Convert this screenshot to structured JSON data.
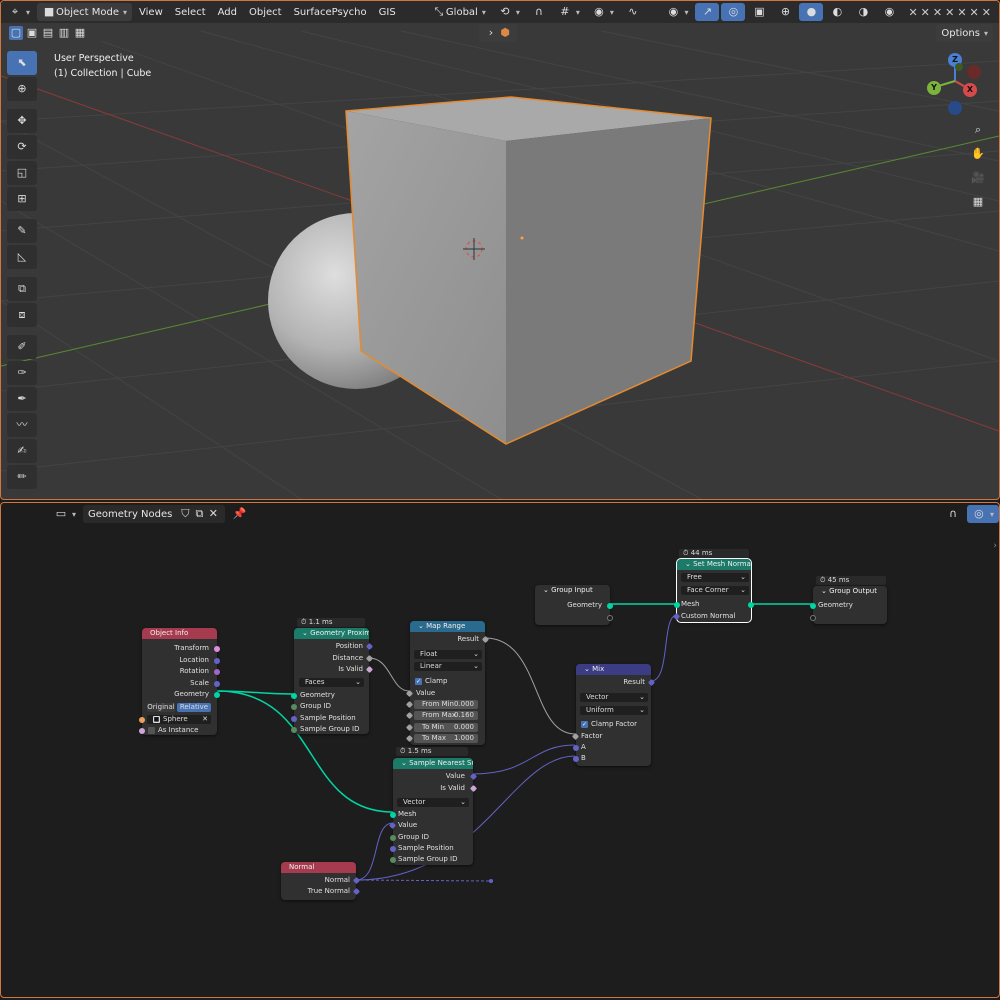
{
  "colors": {
    "active_border": "#d1763f",
    "viewport_bg": "#393939",
    "node_editor_bg": "#1d1d1d",
    "header_input": "#a63a4e",
    "header_geometry": "#1c7a68",
    "header_converter": "#2a6a8e",
    "header_mix": "#3c3c84",
    "socket_geometry": "#00d6a3",
    "socket_vector": "#6363c7",
    "socket_float": "#a1a1a1",
    "socket_bool": "#cca6d6",
    "socket_int": "#598c5c",
    "selection_outline": "#ff9f40"
  },
  "viewport": {
    "header": {
      "editor_icon": "view3d-icon",
      "mode": "Object Mode",
      "menus": [
        "View",
        "Select",
        "Add",
        "Object",
        "SurfacePsycho",
        "GIS"
      ],
      "transform_orientation": "Global",
      "options_label": "Options"
    },
    "overlay_text": {
      "view_name": "User Perspective",
      "collection": "(1) Collection | Cube"
    },
    "gizmo": {
      "x": "X",
      "y": "Y",
      "z": "Z"
    },
    "tools": [
      "select-box-icon",
      "cursor-icon",
      "move-icon",
      "rotate-icon",
      "scale-icon",
      "transform-icon",
      "annotate-icon",
      "measure-icon",
      "add-cube-icon",
      "extrude-icon",
      "paint-icon",
      "paint-sphere-icon",
      "grab-icon",
      "smooth-icon",
      "mask-icon",
      "pose-icon"
    ]
  },
  "node_editor": {
    "header": {
      "editor_icon": "node-editor-icon",
      "tree_name": "Geometry Nodes"
    },
    "nodes": {
      "object_info": {
        "title": "Object Info",
        "outputs": [
          "Transform",
          "Location",
          "Rotation",
          "Scale",
          "Geometry"
        ],
        "mode_options": [
          "Original",
          "Relative"
        ],
        "mode_selected": "Relative",
        "object": "Sphere",
        "as_instance": "As Instance"
      },
      "geometry_proximity": {
        "timing": "1.1 ms",
        "title": "Geometry Proximity",
        "outputs": [
          "Position",
          "Distance",
          "Is Valid"
        ],
        "target_element": "Faces",
        "inputs": [
          "Geometry",
          "Group ID",
          "Sample Position",
          "Sample Group ID"
        ]
      },
      "map_range": {
        "title": "Map Range",
        "output": "Result",
        "data_type": "Float",
        "interpolation": "Linear",
        "clamp": "Clamp",
        "value_label": "Value",
        "fields": [
          {
            "label": "From Min",
            "value": "0.000"
          },
          {
            "label": "From Max",
            "value": "0.160"
          },
          {
            "label": "To Min",
            "value": "0.000"
          },
          {
            "label": "To Max",
            "value": "1.000"
          }
        ]
      },
      "sample_nearest_surface": {
        "timing": "1.5 ms",
        "title": "Sample Nearest Surf...",
        "outputs": [
          "Value",
          "Is Valid"
        ],
        "data_type": "Vector",
        "inputs": [
          "Mesh",
          "Value",
          "Group ID",
          "Sample Position",
          "Sample Group ID"
        ]
      },
      "normal": {
        "title": "Normal",
        "outputs": [
          "Normal",
          "True Normal"
        ]
      },
      "group_input": {
        "title": "Group Input",
        "outputs": [
          "Geometry"
        ]
      },
      "mix": {
        "title": "Mix",
        "output": "Result",
        "data_type": "Vector",
        "factor_mode": "Uniform",
        "clamp_factor": "Clamp Factor",
        "inputs": [
          "Factor",
          "A",
          "B"
        ]
      },
      "set_mesh_normal": {
        "timing": "44 ms",
        "title": "Set Mesh Normal",
        "mode": "Free",
        "domain": "Face Corner",
        "inputs": [
          "Mesh",
          "Custom Normal"
        ]
      },
      "group_output": {
        "timing": "45 ms",
        "title": "Group Output",
        "inputs": [
          "Geometry"
        ]
      }
    }
  }
}
